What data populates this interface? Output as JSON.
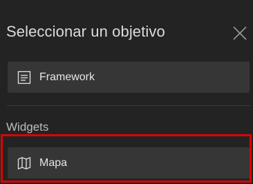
{
  "panel": {
    "title": "Seleccionar un objetivo",
    "close_icon": "close-icon"
  },
  "items": [
    {
      "label": "Framework",
      "icon": "framework-icon"
    }
  ],
  "section": {
    "label": "Widgets",
    "items": [
      {
        "label": "Mapa",
        "icon": "map-icon",
        "highlighted": true
      }
    ]
  },
  "colors": {
    "background": "#232323",
    "item_background": "#363636",
    "text": "#e6e6e6",
    "highlight_border": "#e00000"
  }
}
